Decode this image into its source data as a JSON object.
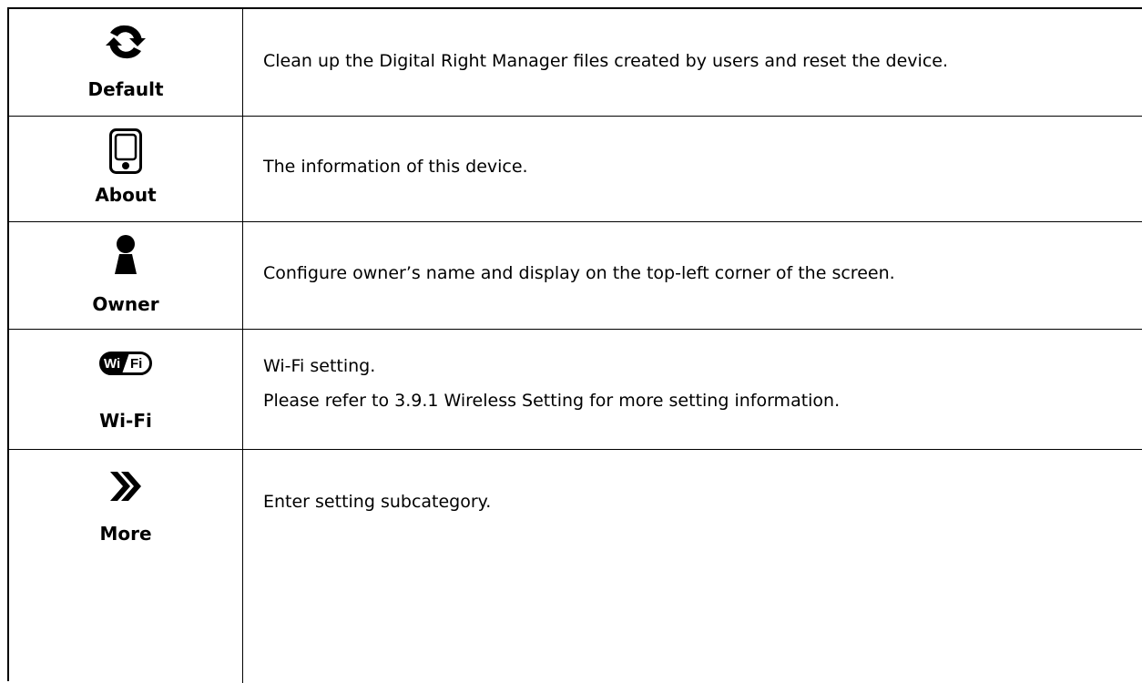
{
  "rows": [
    {
      "icon": "refresh-icon",
      "label": "Default",
      "description": "Clean up the Digital Right Manager files created by users and reset the device."
    },
    {
      "icon": "device-icon",
      "label": "About",
      "description": "The information of this device."
    },
    {
      "icon": "person-icon",
      "label": "Owner",
      "description": "Configure owner’s name and display on the top-left corner of the screen."
    },
    {
      "icon": "wifi-icon",
      "label": "Wi-Fi",
      "description": "Wi-Fi setting.",
      "description_line2": "Please refer to 3.9.1 Wireless Setting for more setting information."
    },
    {
      "icon": "double-chevron-right-icon",
      "label": "More",
      "description": "Enter setting subcategory."
    }
  ],
  "wifi_badge": {
    "left": "Wi",
    "right": "Fi"
  }
}
